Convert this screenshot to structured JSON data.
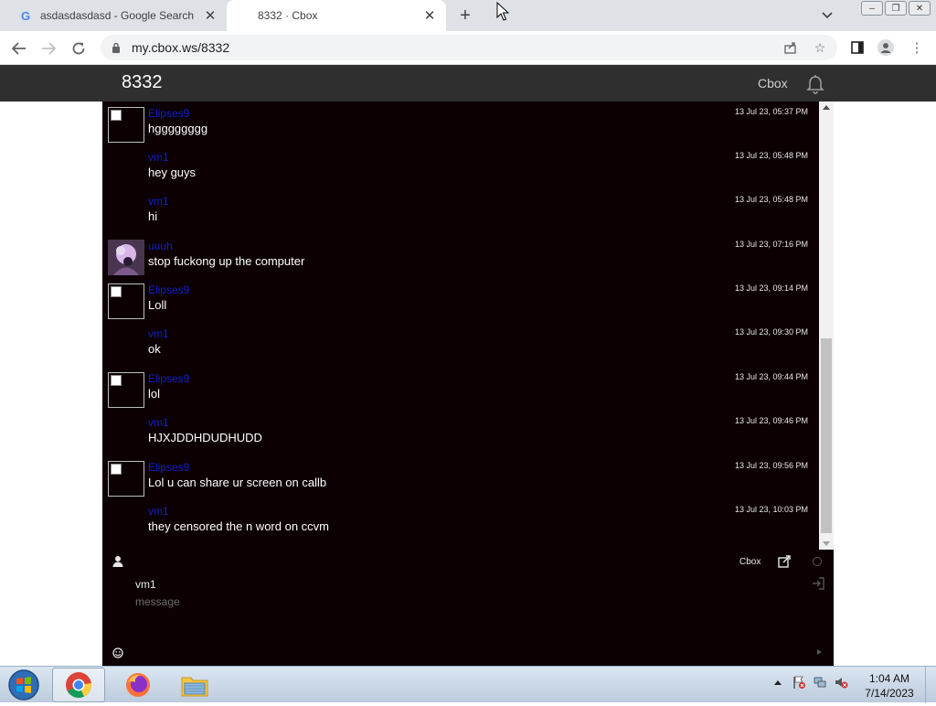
{
  "browser": {
    "tabs": [
      {
        "title": "asdasdasdasd - Google Search",
        "active": false,
        "favicon": "google-g-icon"
      },
      {
        "title": "8332 · Cbox",
        "active": true,
        "favicon": "cbox-icon"
      }
    ],
    "url": "my.cbox.ws/8332"
  },
  "page": {
    "title": "8332",
    "brand": "Cbox"
  },
  "messages": [
    {
      "user": "Elipses9",
      "text": "hgggggggg",
      "time": "13 Jul 23, 05:37 PM",
      "avatar": "broken-image"
    },
    {
      "user": "vm1",
      "text": "hey guys",
      "time": "13 Jul 23, 05:48 PM",
      "avatar": "none"
    },
    {
      "user": "vm1",
      "text": "hi",
      "time": "13 Jul 23, 05:48 PM",
      "avatar": "none"
    },
    {
      "user": "uuuh",
      "text": "stop fuckong up the computer",
      "time": "13 Jul 23, 07:16 PM",
      "avatar": "photo"
    },
    {
      "user": "Elipses9",
      "text": "Loll",
      "time": "13 Jul 23, 09:14 PM",
      "avatar": "broken-image"
    },
    {
      "user": "vm1",
      "text": "ok",
      "time": "13 Jul 23, 09:30 PM",
      "avatar": "none"
    },
    {
      "user": "Elipses9",
      "text": "lol",
      "time": "13 Jul 23, 09:44 PM",
      "avatar": "broken-image"
    },
    {
      "user": "vm1",
      "text": "HJXJDDHDUDHUDD",
      "time": "13 Jul 23, 09:46 PM",
      "avatar": "none"
    },
    {
      "user": "Elipses9",
      "text": "Lol u can share ur screen on callb",
      "time": "13 Jul 23, 09:56 PM",
      "avatar": "broken-image"
    },
    {
      "user": "vm1",
      "text": "they censored the n word on ccvm",
      "time": "13 Jul 23, 10:03 PM",
      "avatar": "none"
    }
  ],
  "chat": {
    "cbox_link": "Cbox",
    "name_value": "vm1",
    "message_placeholder": "message"
  },
  "taskbar": {
    "apps": [
      "chrome",
      "firefox",
      "file-explorer"
    ],
    "time": "1:04 AM",
    "date": "7/14/2023"
  },
  "colors": {
    "chat_background": "#0c0003",
    "username": "#1020c8",
    "header": "#2f2f2f"
  }
}
